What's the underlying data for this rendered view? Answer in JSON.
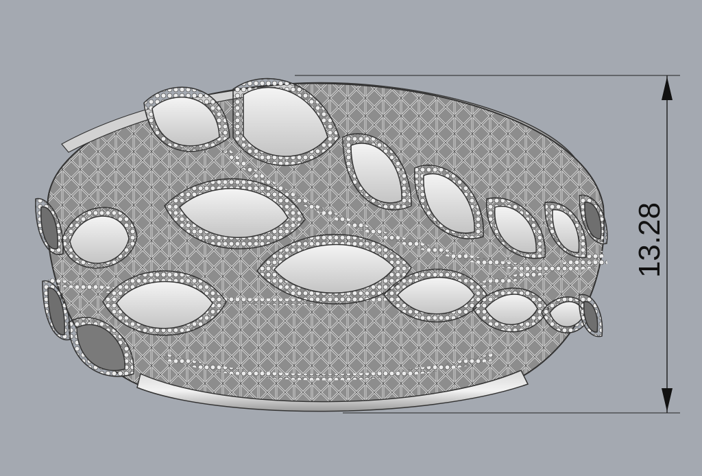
{
  "viewport": {
    "background": "#a4a9b1",
    "object": "ring-3d-render"
  },
  "dimension": {
    "value": "13.28",
    "orientation": "vertical"
  },
  "colors": {
    "metal_light": "#e8e8e8",
    "metal_mid": "#bdbdbd",
    "metal_dark": "#6f6f6f",
    "line": "#3a3a3a",
    "dimension_line": "#222222"
  }
}
